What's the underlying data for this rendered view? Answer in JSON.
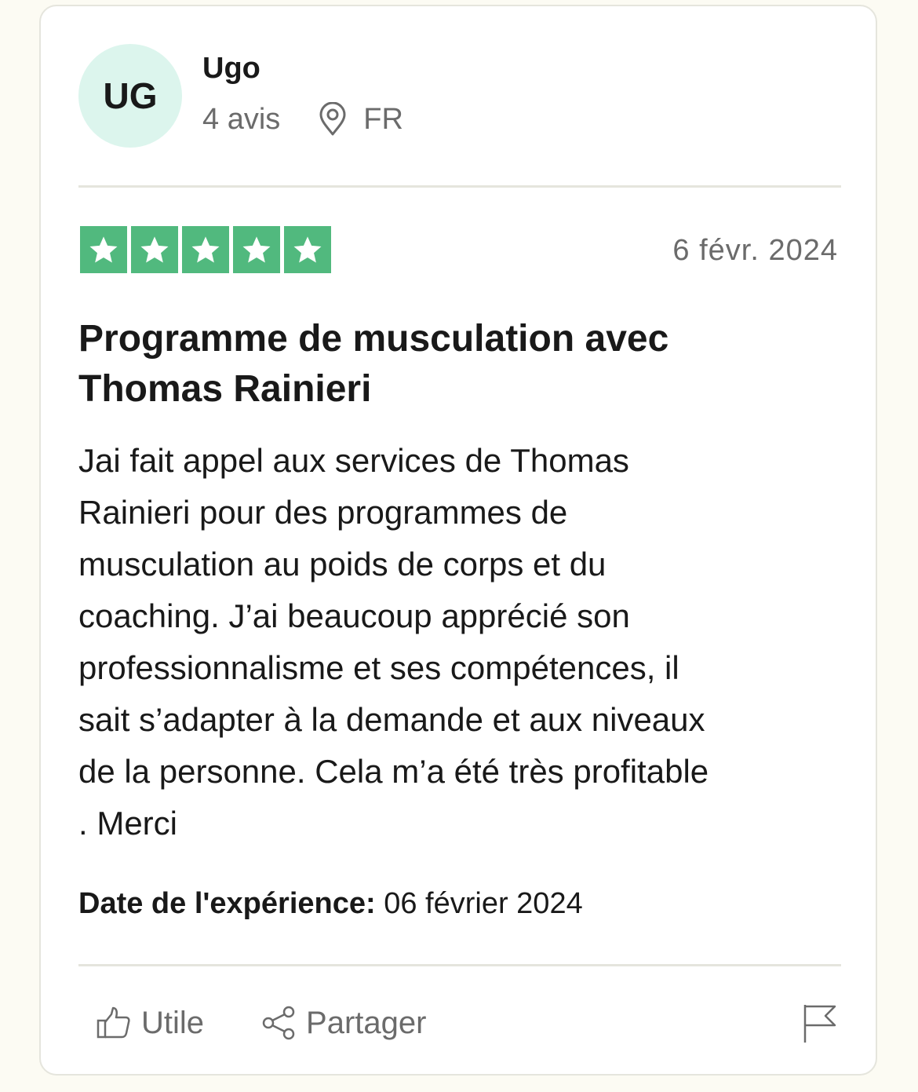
{
  "reviewer": {
    "initials": "UG",
    "name": "Ugo",
    "reviews_count": "4 avis",
    "country": "FR"
  },
  "review": {
    "rating": 5,
    "date": "6 févr. 2024",
    "title": "Programme de musculation avec\nThomas Rainieri",
    "body": "Jai fait appel aux services de Thomas\nRainieri pour des programmes de\nmusculation au poids de corps et du\ncoaching. J’ai beaucoup apprécié son\nprofessionnalisme et ses compétences, il\nsait s’adapter à la demande et aux niveaux\nde la personne. Cela m’a été très profitable\n. Merci",
    "experience_label": "Date de l'expérience:",
    "experience_date": "06 février 2024"
  },
  "actions": {
    "useful_label": "Utile",
    "share_label": "Partager"
  },
  "colors": {
    "star_green": "#51b97e",
    "avatar_bg": "#dcf5ed",
    "page_bg": "#fcfbf3"
  },
  "icons": [
    "map-pin-icon",
    "star-icon",
    "thumbs-up-icon",
    "share-icon",
    "flag-icon"
  ]
}
